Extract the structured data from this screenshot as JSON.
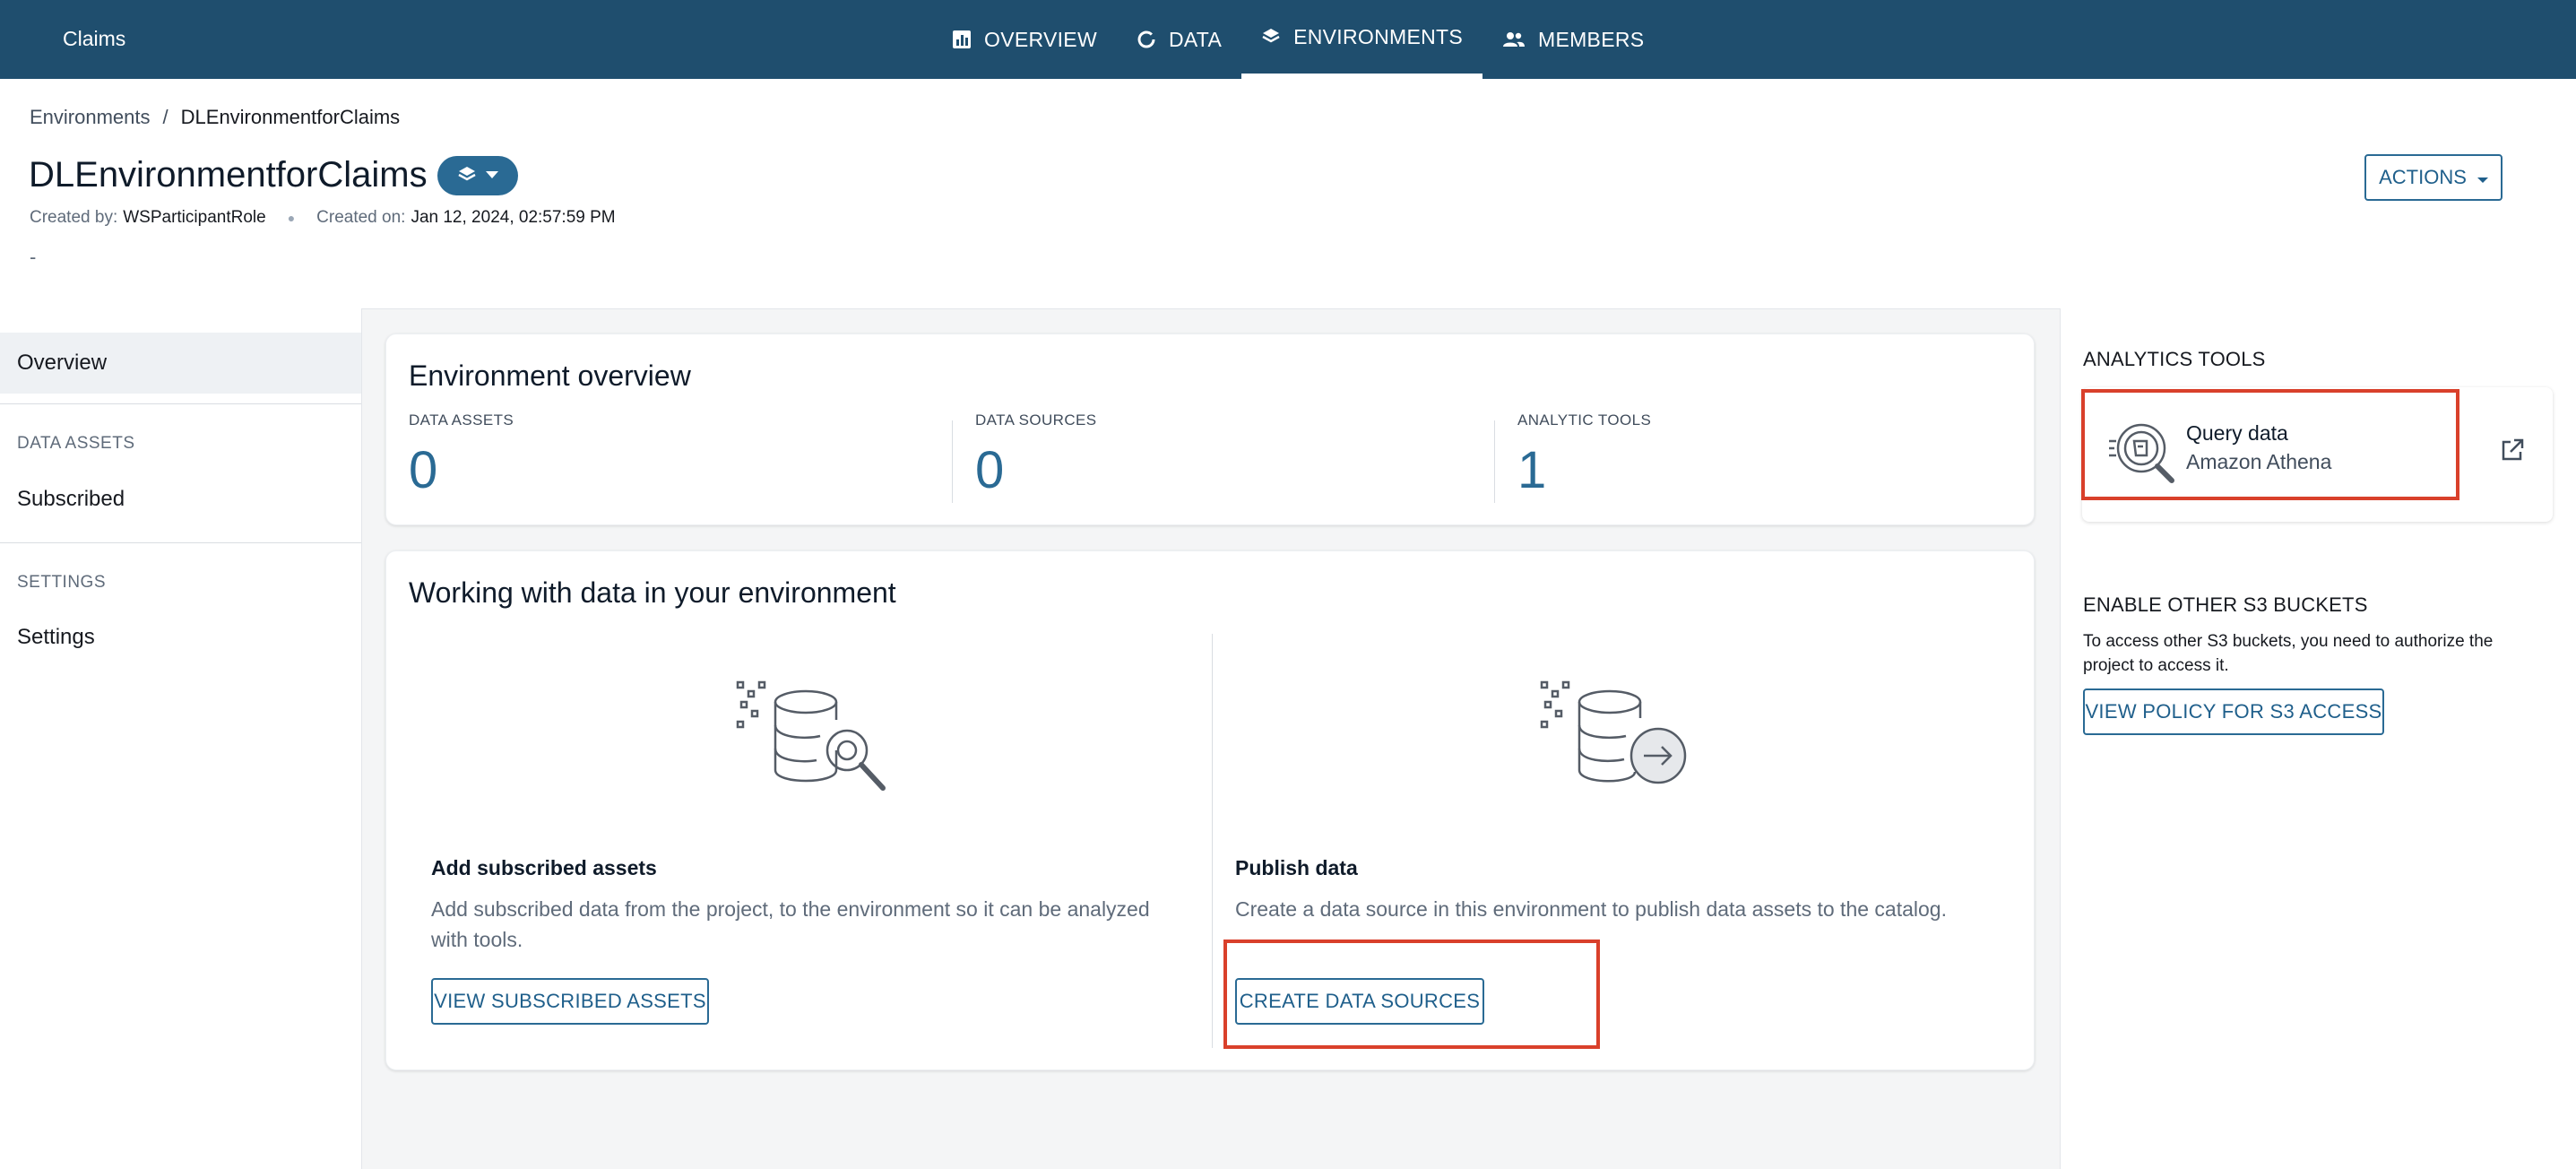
{
  "topnav": {
    "project": "Claims",
    "tabs": [
      {
        "label": "OVERVIEW",
        "icon": "chart-icon",
        "active": false
      },
      {
        "label": "DATA",
        "icon": "circle-icon",
        "active": false
      },
      {
        "label": "ENVIRONMENTS",
        "icon": "layers-icon",
        "active": true
      },
      {
        "label": "MEMBERS",
        "icon": "users-icon",
        "active": false
      }
    ]
  },
  "header": {
    "breadcrumb": {
      "parent": "Environments",
      "separator": "/",
      "current": "DLEnvironmentforClaims"
    },
    "title": "DLEnvironmentforClaims",
    "created_by_label": "Created by:",
    "created_by": "WSParticipantRole",
    "created_on_label": "Created on:",
    "created_on": "Jan 12, 2024, 02:57:59 PM",
    "description": "-",
    "actions_label": "ACTIONS"
  },
  "leftnav": {
    "overview": "Overview",
    "data_assets_section": "DATA ASSETS",
    "subscribed": "Subscribed",
    "settings_section": "SETTINGS",
    "settings": "Settings"
  },
  "overview_card": {
    "title": "Environment overview",
    "stats": [
      {
        "label": "DATA ASSETS",
        "value": "0"
      },
      {
        "label": "DATA SOURCES",
        "value": "0"
      },
      {
        "label": "ANALYTIC TOOLS",
        "value": "1"
      }
    ]
  },
  "working_card": {
    "title": "Working with data in your environment",
    "subscribed": {
      "title": "Add subscribed assets",
      "desc_line1": "Add subscribed data from the project, to the environment so it can be analyzed",
      "desc_line2": "with tools.",
      "button": "VIEW SUBSCRIBED ASSETS"
    },
    "publish": {
      "title": "Publish data",
      "desc": "Create a data source in this environment to publish data assets to the catalog.",
      "button": "CREATE DATA SOURCES"
    }
  },
  "right_panel": {
    "analytics_heading": "ANALYTICS TOOLS",
    "tool_name": "Query data",
    "tool_service": "Amazon Athena",
    "s3_heading": "ENABLE OTHER S3 BUCKETS",
    "s3_desc_line1": "To access other S3 buckets, you need to authorize the",
    "s3_desc_line2": "project to access it.",
    "s3_button": "VIEW POLICY FOR S3 ACCESS"
  },
  "colors": {
    "nav_bg": "#1f4e6e",
    "accent": "#2a6a94",
    "highlight": "#d9402b"
  }
}
